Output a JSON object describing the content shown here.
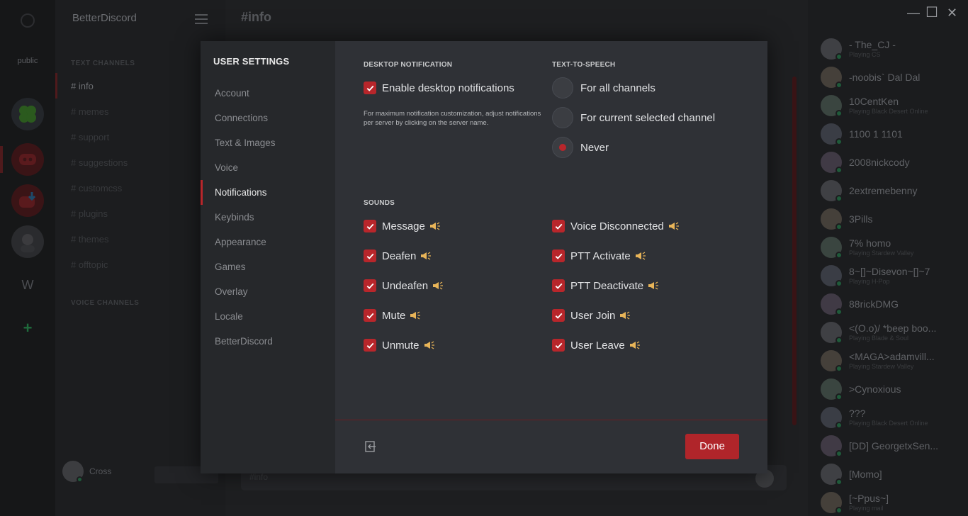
{
  "servers": {
    "items": [
      {
        "label": "public"
      },
      {
        "label": "W"
      }
    ]
  },
  "channels": {
    "guild_name": "BetterDiscord",
    "text_header": "TEXT CHANNELS",
    "items": [
      "# info",
      "# memes",
      "# support",
      "# suggestions",
      "# customcss",
      "# plugins",
      "# themes",
      "# offtopic"
    ],
    "voice_header": "VOICE CHANNELS",
    "user_name": "Cross"
  },
  "chat": {
    "title": "#info",
    "input_placeholder": "#info"
  },
  "window": {
    "minimize": "—",
    "maximize": "☐",
    "close": "✕"
  },
  "members": [
    {
      "name": "- The_CJ -",
      "game": "Playing CS"
    },
    {
      "name": "-noobis` Dal Dal",
      "game": ""
    },
    {
      "name": "10CentKen",
      "game": "Playing Black Desert Online"
    },
    {
      "name": "1100 1 1101",
      "game": ""
    },
    {
      "name": "2008nickcody",
      "game": ""
    },
    {
      "name": "2extremebenny",
      "game": ""
    },
    {
      "name": "3Pills",
      "game": ""
    },
    {
      "name": "7% homo",
      "game": "Playing Stardew Valley"
    },
    {
      "name": "8~[]~Disevon~[]~7",
      "game": "Playing H-Pop"
    },
    {
      "name": "88rickDMG",
      "game": ""
    },
    {
      "name": "<(O.o)/ *beep boo...",
      "game": "Playing Blade & Soul"
    },
    {
      "name": "<MAGA>adamvill...",
      "game": "Playing Stardew Valley"
    },
    {
      "name": ">Cynoxious",
      "game": ""
    },
    {
      "name": "???",
      "game": "Playing Black Desert Online"
    },
    {
      "name": "[DD] GeorgetxSen...",
      "game": ""
    },
    {
      "name": "[Momo]",
      "game": ""
    },
    {
      "name": "[~Ppus~]",
      "game": "Playing mail"
    }
  ],
  "settings": {
    "title": "USER SETTINGS",
    "nav": [
      "Account",
      "Connections",
      "Text & Images",
      "Voice",
      "Notifications",
      "Keybinds",
      "Appearance",
      "Games",
      "Overlay",
      "Locale",
      "BetterDiscord"
    ],
    "active_nav": "Notifications",
    "desktop": {
      "header": "DESKTOP NOTIFICATION",
      "enable_label": "Enable desktop notifications",
      "hint": "For maximum notification customization, adjust notifications per server by clicking on the server name."
    },
    "tts": {
      "header": "TEXT-TO-SPEECH",
      "options": [
        "For all channels",
        "For current selected channel",
        "Never"
      ],
      "selected": "Never"
    },
    "sounds": {
      "header": "SOUNDS",
      "left": [
        "Message",
        "Deafen",
        "Undeafen",
        "Mute",
        "Unmute"
      ],
      "right": [
        "Voice Disconnected",
        "PTT Activate",
        "PTT Deactivate",
        "User Join",
        "User Leave"
      ]
    },
    "done_label": "Done"
  },
  "colors": {
    "accent": "#b8262b",
    "speaker": "#e8b458"
  }
}
